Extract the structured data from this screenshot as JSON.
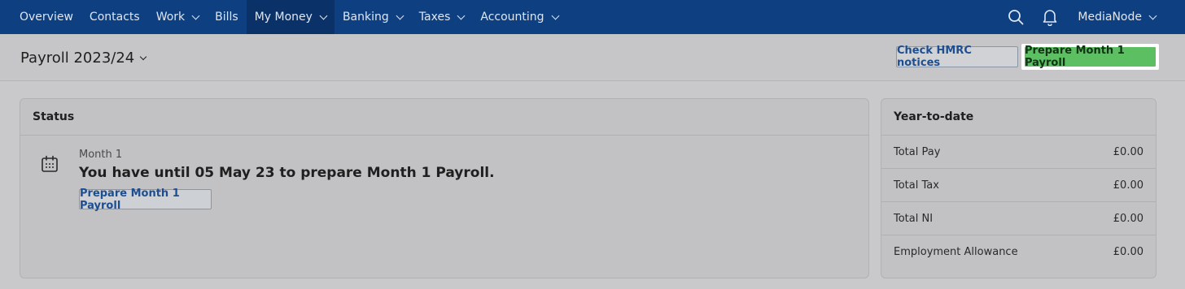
{
  "nav": {
    "items": [
      {
        "label": "Overview",
        "dropdown": false
      },
      {
        "label": "Contacts",
        "dropdown": false
      },
      {
        "label": "Work",
        "dropdown": true
      },
      {
        "label": "Bills",
        "dropdown": false
      },
      {
        "label": "My Money",
        "dropdown": true,
        "active": true
      },
      {
        "label": "Banking",
        "dropdown": true
      },
      {
        "label": "Taxes",
        "dropdown": true
      },
      {
        "label": "Accounting",
        "dropdown": true
      }
    ],
    "search_icon": "search-icon",
    "notifications_icon": "bell-icon",
    "account_name": "MediaNode"
  },
  "header": {
    "title": "Payroll 2023/24",
    "check_hmrc_label": "Check HMRC notices",
    "prepare_label": "Prepare Month 1 Payroll"
  },
  "status": {
    "title": "Status",
    "month_label": "Month 1",
    "deadline_text": "You have until 05 May 23 to prepare Month 1 Payroll.",
    "prepare_button_label": "Prepare Month 1 Payroll",
    "calendar_icon": "calendar-icon"
  },
  "ytd": {
    "title": "Year-to-date",
    "rows": [
      {
        "label": "Total Pay",
        "value": "£0.00"
      },
      {
        "label": "Total Tax",
        "value": "£0.00"
      },
      {
        "label": "Total NI",
        "value": "£0.00"
      },
      {
        "label": "Employment Allowance",
        "value": "£0.00"
      }
    ]
  },
  "colors": {
    "nav_bg": "#0e3f80",
    "primary_button": "#5cc063",
    "link_blue": "#1d4e8f"
  }
}
